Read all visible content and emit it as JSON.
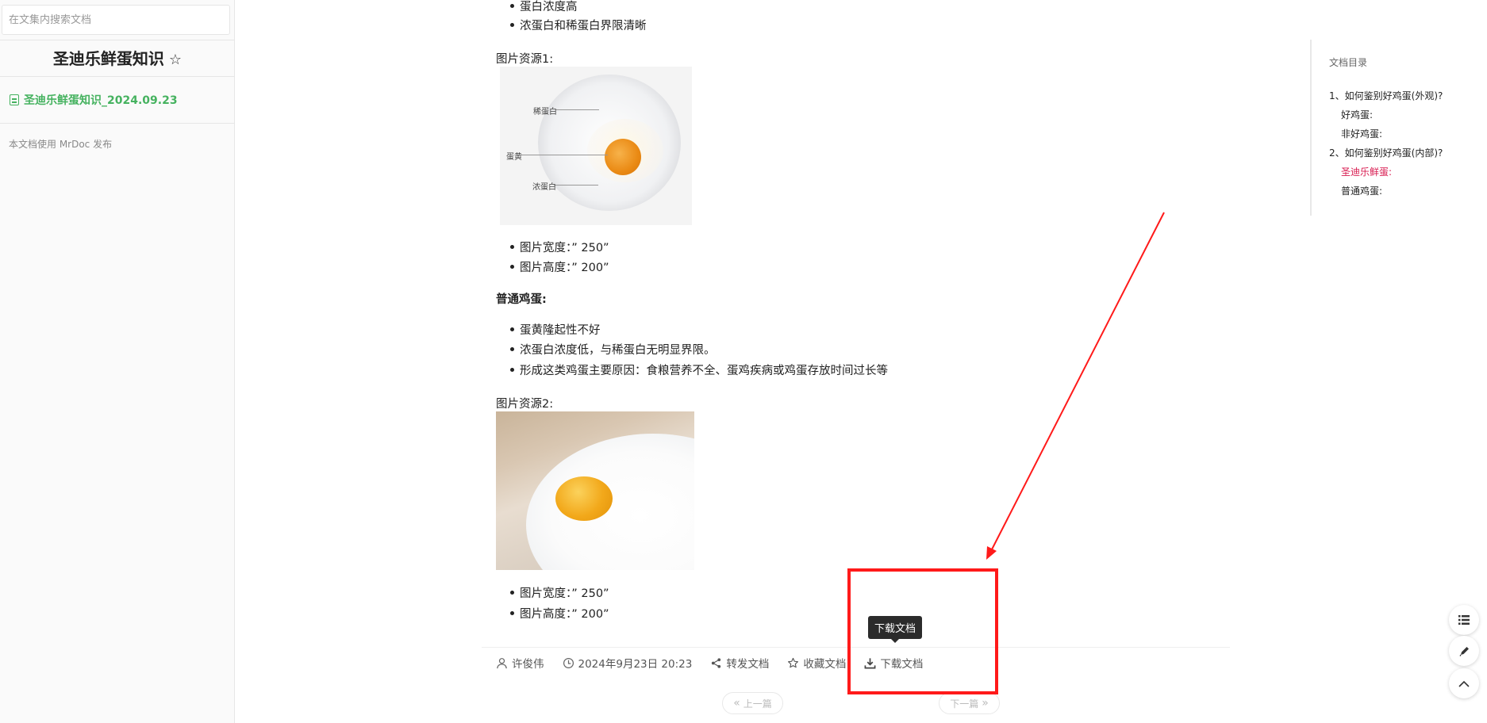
{
  "sidebar": {
    "search_placeholder": "在文集内搜索文档",
    "project_title": "圣迪乐鲜蛋知识",
    "star_icon": "☆",
    "doc_item": "圣迪乐鲜蛋知识_2024.09.23",
    "powered_by": "本文档使用 MrDoc 发布"
  },
  "content": {
    "bullets_top": [
      "蛋白浓度高",
      "浓蛋白和稀蛋白界限清晰"
    ],
    "image1_caption": "图片资源1:",
    "image1_labels": [
      "稀蛋白",
      "蛋黄",
      "浓蛋白"
    ],
    "image1_specs": [
      "图片宽度：” 250”",
      "图片高度：” 200”"
    ],
    "section_heading": "普通鸡蛋:",
    "bullets_normal": [
      "蛋黄隆起性不好",
      "浓蛋白浓度低，与稀蛋白无明显界限。",
      "形成这类鸡蛋主要原因：食粮营养不全、蛋鸡疾病或鸡蛋存放时间过长等"
    ],
    "image2_caption": "图片资源2:",
    "image2_specs": [
      "图片宽度：” 250”",
      "图片高度：” 200”"
    ]
  },
  "meta": {
    "author": "许俊伟",
    "date": "2024年9月23日 20:23",
    "share": "转发文档",
    "collect": "收藏文档",
    "download": "下载文档",
    "tooltip": "下载文档"
  },
  "pager": {
    "prev": "上一篇",
    "next": "下一篇"
  },
  "toc": {
    "title": "文档目录",
    "items": [
      {
        "label": "1、如何鉴别好鸡蛋(外观)?"
      },
      {
        "label": "好鸡蛋:"
      },
      {
        "label": "非好鸡蛋:"
      },
      {
        "label": "2、如何鉴别好鸡蛋(内部)?"
      },
      {
        "label": "圣迪乐鲜蛋:"
      },
      {
        "label": "普通鸡蛋:"
      }
    ],
    "active_color": "#d81b50"
  },
  "colors": {
    "accent_green": "#45b25f",
    "annotation_red": "#ff1a1a"
  }
}
